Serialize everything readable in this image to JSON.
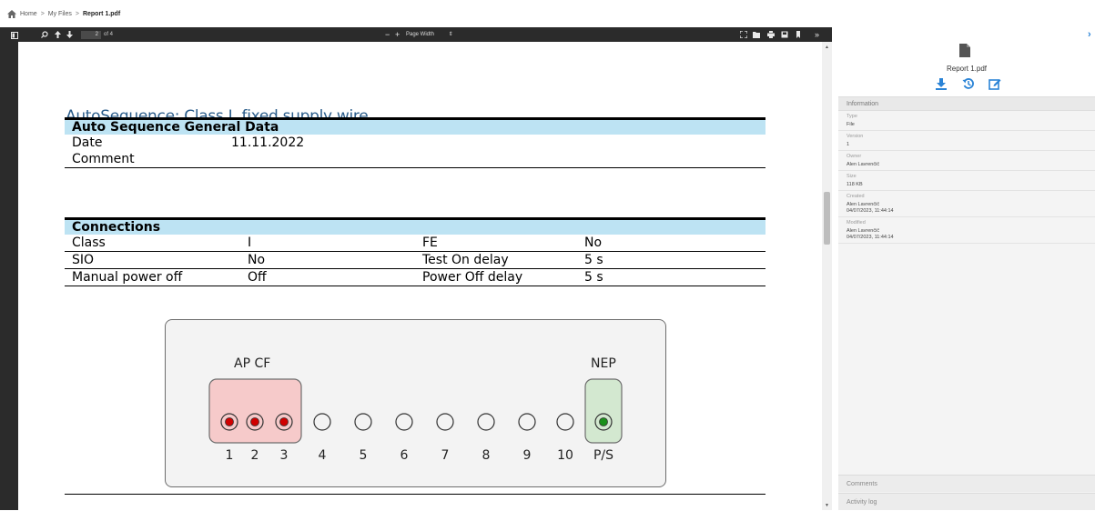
{
  "breadcrumb": {
    "home": "Home",
    "my_files": "My Files",
    "current": "Report 1.pdf",
    "separator": ">"
  },
  "viewer": {
    "page_number": "2",
    "page_of": "of 4",
    "zoom_label": "Page Width",
    "zoom_out": "−",
    "zoom_in": "+",
    "more": "»"
  },
  "document": {
    "title": "AutoSequence: Class I, fixed supply wire",
    "general": {
      "heading": "Auto Sequence General Data",
      "rows": [
        {
          "label": "Date",
          "value": "11.11.2022"
        },
        {
          "label": "Comment",
          "value": ""
        }
      ]
    },
    "connections": {
      "heading": "Connections",
      "rows": [
        {
          "label": "Class",
          "value": "I",
          "label2": "FE",
          "value2": "No"
        },
        {
          "label": "SIO",
          "value": "No",
          "label2": "Test On delay",
          "value2": "5 s"
        },
        {
          "label": "Manual power off",
          "value": "Off",
          "label2": "Power Off delay",
          "value2": "5 s"
        }
      ]
    },
    "diagram": {
      "group_left": "AP CF",
      "group_right": "NEP",
      "terminals": [
        "1",
        "2",
        "3",
        "4",
        "5",
        "6",
        "7",
        "8",
        "9",
        "10",
        "P/S"
      ],
      "active_color": "#d00000",
      "nep_color": "#1a8f1a"
    }
  },
  "sidebar": {
    "file_name": "Report 1.pdf",
    "info_header": "Information",
    "fields": [
      {
        "label": "Type",
        "value": "File"
      },
      {
        "label": "Version",
        "value": "1"
      },
      {
        "label": "Owner",
        "value": "Alen Lavrenčič"
      },
      {
        "label": "Size",
        "value": "118 KB"
      },
      {
        "label": "Created",
        "value": "Alen Lavrenčič",
        "value2": "04/07/2023, 11:44:14"
      },
      {
        "label": "Modified",
        "value": "Alen Lavrenčič",
        "value2": "04/07/2023, 11:44:14"
      }
    ],
    "comments": "Comments",
    "activity_log": "Activity log"
  },
  "colors": {
    "accent": "#2a83d6",
    "table_header_bg": "#bde3f3",
    "title": "#2a5c8a"
  }
}
